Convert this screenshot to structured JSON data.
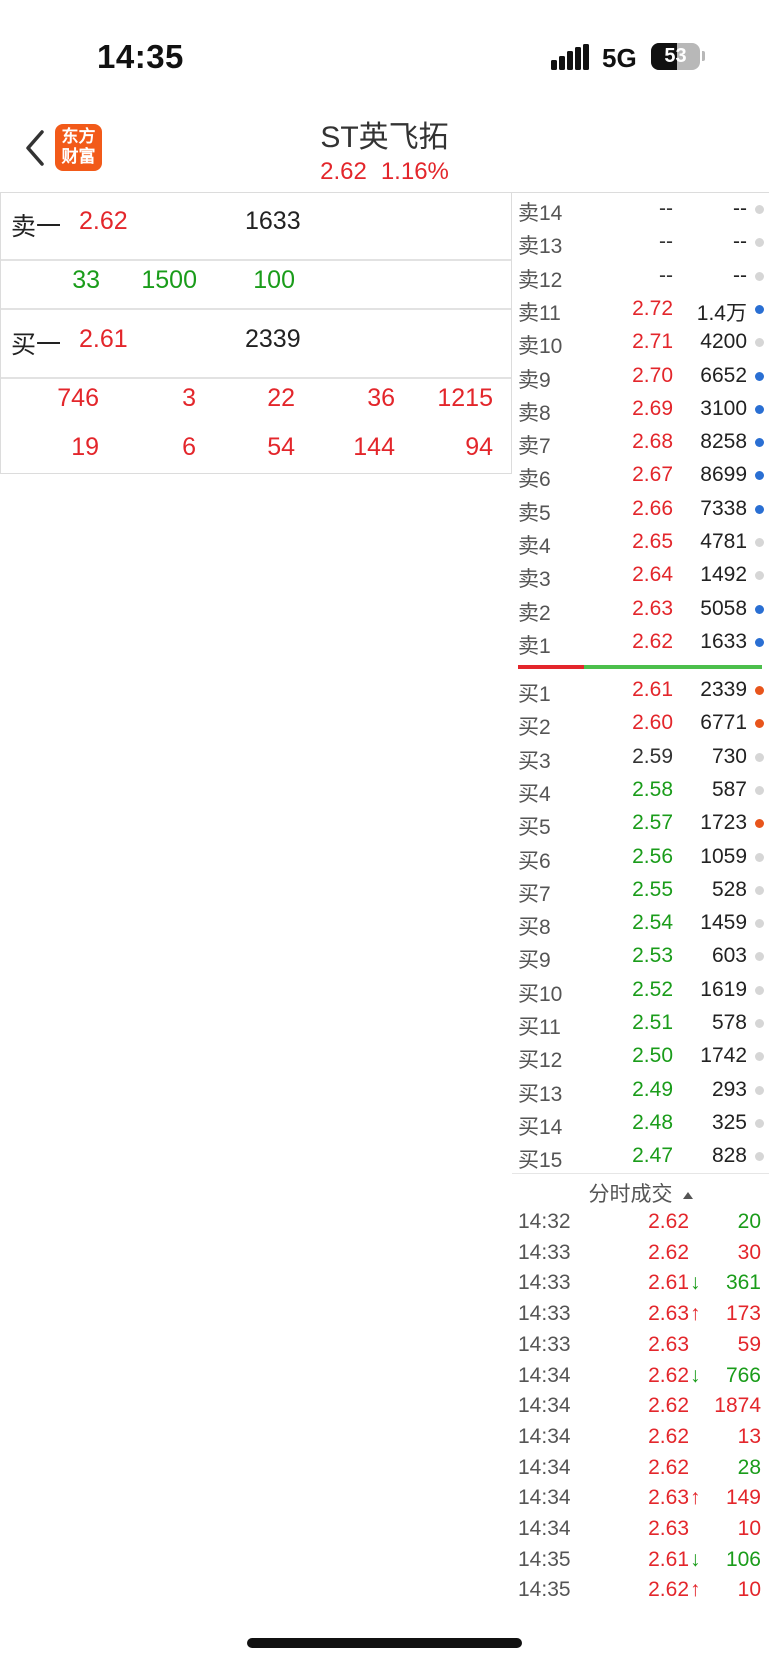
{
  "status_bar": {
    "time": "14:35",
    "network": "5G",
    "battery": "53",
    "battery_level": 0.53
  },
  "header": {
    "logo_line1": "东方",
    "logo_line2": "财富",
    "stock_name": "ST英飞拓",
    "price": "2.62",
    "change_pct": "1.16%"
  },
  "level1": {
    "sell1": {
      "label": "卖一",
      "price": "2.62",
      "volume": "1633"
    },
    "sell_queue": [
      "33",
      "1500",
      "100"
    ],
    "buy1": {
      "label": "买一",
      "price": "2.61",
      "volume": "2339"
    },
    "buy_queue_row1": [
      "746",
      "3",
      "22",
      "36",
      "1215"
    ],
    "buy_queue_row2": [
      "19",
      "6",
      "54",
      "144",
      "94"
    ]
  },
  "order_book": {
    "asks": [
      {
        "label": "卖14",
        "price": "--",
        "volume": "--",
        "price_color": "dark",
        "dot": "gray"
      },
      {
        "label": "卖13",
        "price": "--",
        "volume": "--",
        "price_color": "dark",
        "dot": "gray"
      },
      {
        "label": "卖12",
        "price": "--",
        "volume": "--",
        "price_color": "dark",
        "dot": "gray"
      },
      {
        "label": "卖11",
        "price": "2.72",
        "volume": "1.4万",
        "price_color": "red",
        "dot": "blue"
      },
      {
        "label": "卖10",
        "price": "2.71",
        "volume": "4200",
        "price_color": "red",
        "dot": "gray"
      },
      {
        "label": "卖9",
        "price": "2.70",
        "volume": "6652",
        "price_color": "red",
        "dot": "blue"
      },
      {
        "label": "卖8",
        "price": "2.69",
        "volume": "3100",
        "price_color": "red",
        "dot": "blue"
      },
      {
        "label": "卖7",
        "price": "2.68",
        "volume": "8258",
        "price_color": "red",
        "dot": "blue"
      },
      {
        "label": "卖6",
        "price": "2.67",
        "volume": "8699",
        "price_color": "red",
        "dot": "blue"
      },
      {
        "label": "卖5",
        "price": "2.66",
        "volume": "7338",
        "price_color": "red",
        "dot": "blue"
      },
      {
        "label": "卖4",
        "price": "2.65",
        "volume": "4781",
        "price_color": "red",
        "dot": "gray"
      },
      {
        "label": "卖3",
        "price": "2.64",
        "volume": "1492",
        "price_color": "red",
        "dot": "gray"
      },
      {
        "label": "卖2",
        "price": "2.63",
        "volume": "5058",
        "price_color": "red",
        "dot": "blue"
      },
      {
        "label": "卖1",
        "price": "2.62",
        "volume": "1633",
        "price_color": "red",
        "dot": "blue"
      }
    ],
    "bids": [
      {
        "label": "买1",
        "price": "2.61",
        "volume": "2339",
        "price_color": "red",
        "dot": "orange"
      },
      {
        "label": "买2",
        "price": "2.60",
        "volume": "6771",
        "price_color": "red",
        "dot": "orange"
      },
      {
        "label": "买3",
        "price": "2.59",
        "volume": "730",
        "price_color": "dark",
        "dot": "gray"
      },
      {
        "label": "买4",
        "price": "2.58",
        "volume": "587",
        "price_color": "green",
        "dot": "gray"
      },
      {
        "label": "买5",
        "price": "2.57",
        "volume": "1723",
        "price_color": "green",
        "dot": "orange"
      },
      {
        "label": "买6",
        "price": "2.56",
        "volume": "1059",
        "price_color": "green",
        "dot": "gray"
      },
      {
        "label": "买7",
        "price": "2.55",
        "volume": "528",
        "price_color": "green",
        "dot": "gray"
      },
      {
        "label": "买8",
        "price": "2.54",
        "volume": "1459",
        "price_color": "green",
        "dot": "gray"
      },
      {
        "label": "买9",
        "price": "2.53",
        "volume": "603",
        "price_color": "green",
        "dot": "gray"
      },
      {
        "label": "买10",
        "price": "2.52",
        "volume": "1619",
        "price_color": "green",
        "dot": "gray"
      },
      {
        "label": "买11",
        "price": "2.51",
        "volume": "578",
        "price_color": "green",
        "dot": "gray"
      },
      {
        "label": "买12",
        "price": "2.50",
        "volume": "1742",
        "price_color": "green",
        "dot": "gray"
      },
      {
        "label": "买13",
        "price": "2.49",
        "volume": "293",
        "price_color": "green",
        "dot": "gray"
      },
      {
        "label": "买14",
        "price": "2.48",
        "volume": "325",
        "price_color": "green",
        "dot": "gray"
      },
      {
        "label": "买15",
        "price": "2.47",
        "volume": "828",
        "price_color": "green",
        "dot": "gray"
      }
    ]
  },
  "trades": {
    "title": "分时成交",
    "rows": [
      {
        "time": "14:32",
        "price": "2.62",
        "arrow": "",
        "volume": "20",
        "volume_color": "green"
      },
      {
        "time": "14:33",
        "price": "2.62",
        "arrow": "",
        "volume": "30",
        "volume_color": "red"
      },
      {
        "time": "14:33",
        "price": "2.61",
        "arrow": "↓",
        "volume": "361",
        "volume_color": "green"
      },
      {
        "time": "14:33",
        "price": "2.63",
        "arrow": "↑",
        "volume": "173",
        "volume_color": "red"
      },
      {
        "time": "14:33",
        "price": "2.63",
        "arrow": "",
        "volume": "59",
        "volume_color": "red"
      },
      {
        "time": "14:34",
        "price": "2.62",
        "arrow": "↓",
        "volume": "766",
        "volume_color": "green"
      },
      {
        "time": "14:34",
        "price": "2.62",
        "arrow": "",
        "volume": "1874",
        "volume_color": "red"
      },
      {
        "time": "14:34",
        "price": "2.62",
        "arrow": "",
        "volume": "13",
        "volume_color": "red"
      },
      {
        "time": "14:34",
        "price": "2.62",
        "arrow": "",
        "volume": "28",
        "volume_color": "green"
      },
      {
        "time": "14:34",
        "price": "2.63",
        "arrow": "↑",
        "volume": "149",
        "volume_color": "red"
      },
      {
        "time": "14:34",
        "price": "2.63",
        "arrow": "",
        "volume": "10",
        "volume_color": "red"
      },
      {
        "time": "14:35",
        "price": "2.61",
        "arrow": "↓",
        "volume": "106",
        "volume_color": "green"
      },
      {
        "time": "14:35",
        "price": "2.62",
        "arrow": "↑",
        "volume": "10",
        "volume_color": "red"
      }
    ]
  },
  "colors": {
    "up": "#e3262b",
    "down": "#1a9c1a",
    "brand": "#f25a19",
    "dot_blue": "#2a6fd3",
    "dot_orange": "#e8551c"
  }
}
